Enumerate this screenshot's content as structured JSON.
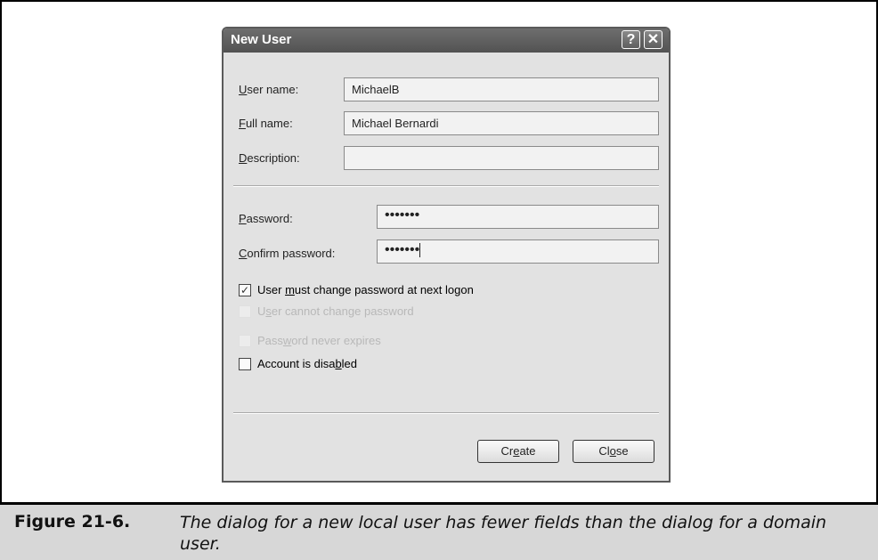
{
  "dialog": {
    "title": "New User",
    "help_glyph": "?",
    "close_glyph": "✕"
  },
  "fields": {
    "username": {
      "label_u": "U",
      "label_rest": "ser name:",
      "value": "MichaelB"
    },
    "fullname": {
      "label_u": "F",
      "label_rest": "ull name:",
      "value": "Michael Bernardi"
    },
    "description": {
      "label_u": "D",
      "label_rest": "escription:",
      "value": ""
    },
    "password": {
      "label_u": "P",
      "label_rest": "assword:",
      "value": "•••••••"
    },
    "confirm": {
      "label_u": "C",
      "label_rest": "onfirm password:",
      "value": "•••••••"
    }
  },
  "options": {
    "must_change": {
      "pre": "User ",
      "u": "m",
      "post": "ust change password at next logon",
      "checked": true,
      "enabled": true,
      "mark": "✓"
    },
    "cannot_change": {
      "pre": "U",
      "u": "s",
      "post": "er cannot change password",
      "checked": false,
      "enabled": false
    },
    "never_expires": {
      "pre": "Pass",
      "u": "w",
      "post": "ord never expires",
      "checked": false,
      "enabled": false
    },
    "disabled": {
      "pre": "Account is disa",
      "u": "b",
      "post": "led",
      "checked": false,
      "enabled": true
    }
  },
  "buttons": {
    "create": {
      "pre": "Cr",
      "u": "e",
      "post": "ate"
    },
    "close": {
      "pre": "Cl",
      "u": "o",
      "post": "se"
    }
  },
  "caption": {
    "label": "Figure 21-6.",
    "text": "The dialog for a new local user has fewer fields than the dialog for a domain user."
  }
}
